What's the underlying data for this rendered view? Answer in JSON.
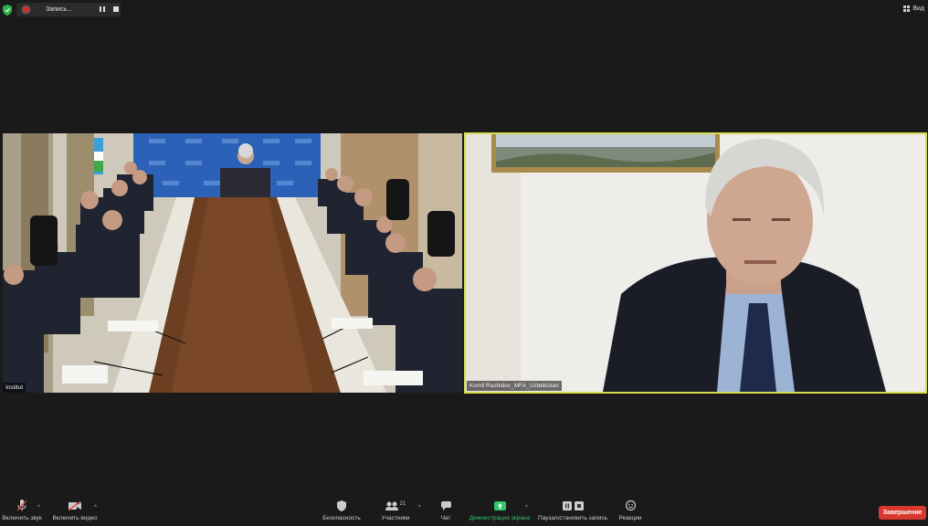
{
  "topbar": {
    "recording_label": "Запись...",
    "view_label": "Вид",
    "icons": [
      "shield-icon",
      "record-dot-icon",
      "pause-icon",
      "stop-icon",
      "grid-view-icon"
    ]
  },
  "tiles": [
    {
      "name": "Institut",
      "highlighted": false
    },
    {
      "name": "Komil Rashidov_MFA_Uzbekistan",
      "highlighted": true,
      "border_color": "#d5dd4f"
    }
  ],
  "toolbar": {
    "unmute_label": "Включить звук",
    "start_video_label": "Включить видео",
    "security_label": "Безопасность",
    "participants_label": "Участники",
    "participants_count": "21",
    "chat_label": "Чат",
    "share_label": "Демонстрация экрана",
    "share_color": "#2dc96b",
    "pause_stop_recording_label": "Пауза/остановить запись",
    "reactions_label": "Реакции",
    "end_label": "Завершение",
    "end_color": "#d9382f"
  }
}
